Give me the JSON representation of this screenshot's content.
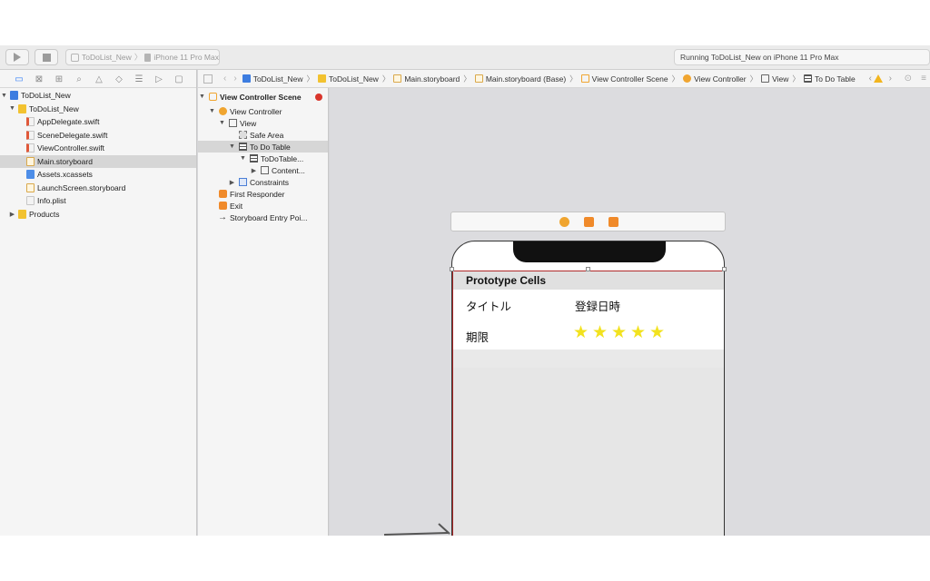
{
  "toolbar": {
    "run_icon": "play-icon",
    "stop_icon": "stop-icon",
    "scheme_project": "ToDoList_New",
    "scheme_device": "iPhone 11 Pro Max",
    "status": "Running ToDoList_New on iPhone 11 Pro Max"
  },
  "navigator": {
    "tabs": [
      "folder-icon",
      "source-control-icon",
      "hierarchy-icon",
      "search-icon",
      "warning-icon",
      "test-icon",
      "debug-icon",
      "breakpoint-icon",
      "report-icon"
    ],
    "items": [
      {
        "label": "ToDoList_New",
        "kind": "project"
      },
      {
        "label": "ToDoList_New",
        "kind": "folder"
      },
      {
        "label": "AppDelegate.swift",
        "kind": "swift"
      },
      {
        "label": "SceneDelegate.swift",
        "kind": "swift"
      },
      {
        "label": "ViewController.swift",
        "kind": "swift"
      },
      {
        "label": "Main.storyboard",
        "kind": "storyboard"
      },
      {
        "label": "Assets.xcassets",
        "kind": "assets"
      },
      {
        "label": "LaunchScreen.storyboard",
        "kind": "storyboard"
      },
      {
        "label": "Info.plist",
        "kind": "plist"
      },
      {
        "label": "Products",
        "kind": "folder"
      }
    ]
  },
  "outline": {
    "items": [
      {
        "label": "View Controller Scene"
      },
      {
        "label": "View Controller"
      },
      {
        "label": "View"
      },
      {
        "label": "Safe Area"
      },
      {
        "label": "To Do Table"
      },
      {
        "label": "ToDoTable..."
      },
      {
        "label": "Content..."
      },
      {
        "label": "Constraints"
      },
      {
        "label": "First Responder"
      },
      {
        "label": "Exit"
      },
      {
        "label": "Storyboard Entry Poi..."
      }
    ]
  },
  "jumpbar": {
    "segments": [
      "ToDoList_New",
      "ToDoList_New",
      "Main.storyboard",
      "Main.storyboard (Base)",
      "View Controller Scene",
      "View Controller",
      "View",
      "To Do Table"
    ]
  },
  "canvas": {
    "section_header": "Prototype Cells",
    "cell_title_label": "タイトル",
    "cell_date_label": "登録日時",
    "cell_deadline_label": "期限",
    "stars": [
      "★",
      "★",
      "★",
      "★",
      "★"
    ]
  },
  "colors": {
    "selection": "#d6d6d6",
    "star": "#f2e21e",
    "storyboard_orange": "#f0a530",
    "error_red": "#d9352b",
    "table_border": "#b02a2a"
  }
}
